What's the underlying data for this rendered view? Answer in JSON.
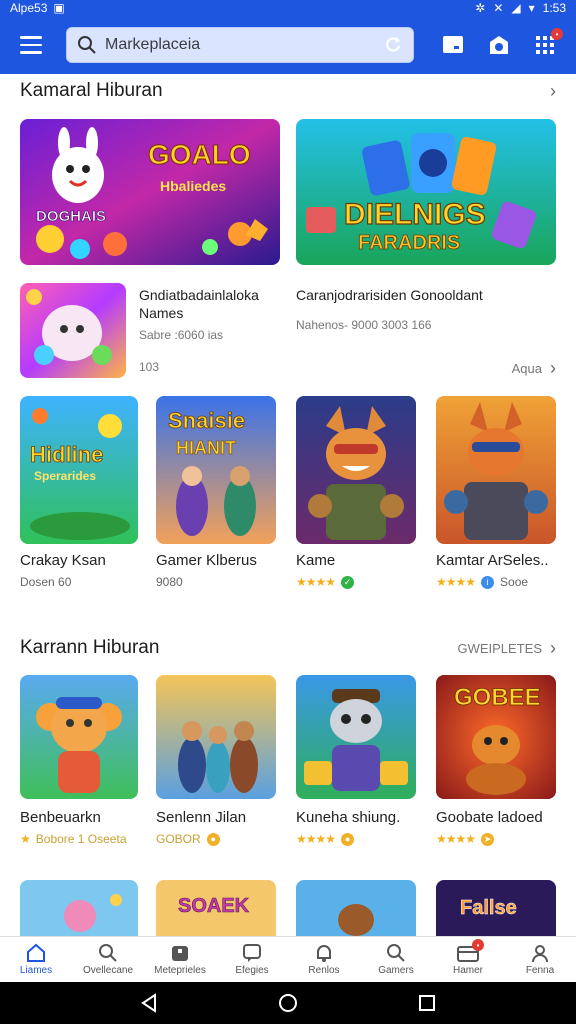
{
  "status_bar": {
    "time": "Alpe53",
    "battery": "1:53"
  },
  "app_bar": {
    "search_placeholder": "Markeplaceia"
  },
  "section1": {
    "title": "Kamaral Hiburan",
    "featured": [
      {
        "art_text": "GOALO",
        "art_sub": "DOGHAIS"
      },
      {
        "art_text": "DIELNIGS",
        "art_sub": "FARADRIS"
      }
    ],
    "list_items": [
      {
        "title": "Gndiatbadainlaloka Names",
        "meta": "Sabre :6060   ias"
      },
      {
        "title": "Caranjodrarisiden Gonooldant",
        "meta": "Nahenos- 9000   3003   166"
      }
    ],
    "footer_left": "103",
    "footer_more": "Aqua",
    "tiles": [
      {
        "name": "Crakay Ksan",
        "sub": "Dosen 60"
      },
      {
        "name": "Gamer Klberus",
        "sub": "9080"
      },
      {
        "name": "Kame",
        "sub": ""
      },
      {
        "name": "Kamtar ArSeles..",
        "sub": "Sooe"
      }
    ],
    "tile_art_titles": [
      "Hidline",
      "Snaisie"
    ]
  },
  "section2": {
    "title": "Karrann Hiburan",
    "more_label": "GWEIPLETES",
    "tiles": [
      {
        "name": "Benbeuarkn",
        "sub": "Bobore 1 Oseeta"
      },
      {
        "name": "Senlenn Jilan",
        "sub": "GOBOR"
      },
      {
        "name": "Kuneha shiung.",
        "sub": ""
      },
      {
        "name": "Goobate ladoed",
        "sub": ""
      }
    ],
    "tile_art_titles": [
      "GOBEE"
    ],
    "row2_art_titles": [
      "SOAEK",
      "Fallse"
    ]
  },
  "bottom_nav": [
    {
      "label": "Liames",
      "icon": "home-icon"
    },
    {
      "label": "Ovellecane",
      "icon": "search-icon"
    },
    {
      "label": "Meteprieles",
      "icon": "store-icon"
    },
    {
      "label": "Efegies",
      "icon": "chat-icon"
    },
    {
      "label": "Renlos",
      "icon": "bell-icon"
    },
    {
      "label": "Gamers",
      "icon": "search-icon"
    },
    {
      "label": "Hamer",
      "icon": "card-icon"
    },
    {
      "label": "Fenna",
      "icon": "profile-icon"
    }
  ],
  "colors": {
    "primary": "#1f56e0",
    "star": "#f3b01b"
  }
}
